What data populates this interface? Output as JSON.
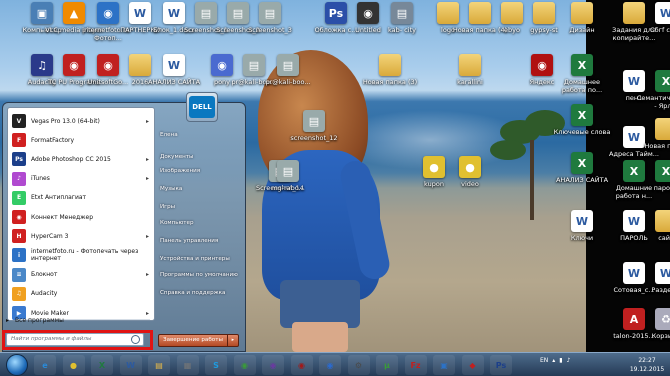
{
  "desktop_icons": [
    {
      "label": "Компьютер",
      "icon": "computer-icon",
      "color": "#4a7fb5",
      "x": "c"
    },
    {
      "label": "VLC media player",
      "icon": "vlc-icon",
      "color": "#f08a00"
    },
    {
      "label": "internetfoto.ru - Фотоп...",
      "icon": "app-icon",
      "color": "#2c72c6"
    },
    {
      "label": "ПАРТНЕРКИ",
      "icon": "doc-icon",
      "color": "#ffffff"
    },
    {
      "label": "Блок_1.docx",
      "icon": "doc-icon",
      "color": "#ffffff"
    },
    {
      "label": "Screenshot_1",
      "icon": "image-icon",
      "color": "#9aa"
    },
    {
      "label": "Screenshot_2",
      "icon": "image-icon",
      "color": "#9aa"
    },
    {
      "label": "Screenshot_3",
      "icon": "image-icon",
      "color": "#9aa"
    },
    {
      "label": "Обложка с...",
      "icon": "photoshop-icon",
      "color": "#2b4fa8"
    },
    {
      "label": "Untitled",
      "icon": "app-icon",
      "color": "#333"
    },
    {
      "label": "kab- city",
      "icon": "image-icon",
      "color": "#789"
    },
    {
      "label": "logo",
      "icon": "folder-icon",
      "color": "#e5b94a"
    },
    {
      "label": "Новая папка (4)",
      "icon": "folder-icon",
      "color": "#e5b94a"
    },
    {
      "label": "ebyo",
      "icon": "folder-icon",
      "color": "#e5b94a"
    },
    {
      "label": "gypsy-st",
      "icon": "folder-icon",
      "color": "#e5b94a"
    },
    {
      "label": "Дизайн",
      "icon": "folder-icon",
      "color": "#e5b94a"
    },
    {
      "label": "Задания для копирайте...",
      "icon": "folder-icon",
      "color": "#e5b94a"
    },
    {
      "label": "Сбгf сайт",
      "icon": "doc-icon",
      "color": "#ffffff"
    },
    {
      "label": "Audacity",
      "icon": "audacity-icon",
      "color": "#2a3a8a"
    },
    {
      "label": "TC PU Programs",
      "icon": "app-icon",
      "color": "#c02020"
    },
    {
      "label": "UnitsoftGo...",
      "icon": "app-icon",
      "color": "#c02020"
    },
    {
      "label": "2016",
      "icon": "folder-icon",
      "color": "#e5b94a"
    },
    {
      "label": "АНАЛИЗ САЙТА",
      "icon": "doc-icon",
      "color": "#ffffff"
    },
    {
      "label": "pony",
      "icon": "app-icon",
      "color": "#4a6ad0"
    },
    {
      "label": "pr@kali-boo...",
      "icon": "image-icon",
      "color": "#9aa"
    },
    {
      "label": "pr@kali-boo...",
      "icon": "image-icon",
      "color": "#9aa"
    },
    {
      "label": "screenshot_12",
      "icon": "image-icon",
      "color": "#9aa"
    },
    {
      "label": "Новая папка (3)",
      "icon": "folder-icon",
      "color": "#e5b94a"
    },
    {
      "label": "karallini",
      "icon": "folder-icon",
      "color": "#e5b94a"
    },
    {
      "label": "Яндекс",
      "icon": "app-icon",
      "color": "#b01010"
    },
    {
      "label": "Домашнее работа по...",
      "icon": "xls-icon",
      "color": "#1f7a3e"
    },
    {
      "label": "пен1",
      "icon": "doc-icon",
      "color": "#ffffff"
    },
    {
      "label": "Семантич... ядро - Ярл...",
      "icon": "xls-icon",
      "color": "#1f7a3e"
    },
    {
      "label": "Screenshot_14",
      "icon": "image-icon",
      "color": "#9aa"
    },
    {
      "label": "Ключевые слова",
      "icon": "xls-icon",
      "color": "#1f7a3e"
    },
    {
      "label": "Адреса Тайм...",
      "icon": "doc-icon",
      "color": "#ffffff"
    },
    {
      "label": "Новая папка",
      "icon": "folder-icon",
      "color": "#e5b94a"
    },
    {
      "label": "mg-rabo...",
      "icon": "image-icon",
      "color": "#9aa"
    },
    {
      "label": "kupon",
      "icon": "chrome-icon",
      "color": "#e0c030"
    },
    {
      "label": "video",
      "icon": "chrome-icon",
      "color": "#e0c030"
    },
    {
      "label": "АНАЛИЗ САЙТА",
      "icon": "xls-icon",
      "color": "#1f7a3e"
    },
    {
      "label": "Домашние работа н...",
      "icon": "xls-icon",
      "color": "#1f7a3e"
    },
    {
      "label": "пароли",
      "icon": "xls-icon",
      "color": "#1f7a3e"
    },
    {
      "label": "Ключи",
      "icon": "doc-icon",
      "color": "#ffffff"
    },
    {
      "label": "ПАРОЛЬ",
      "icon": "doc-icon",
      "color": "#ffffff"
    },
    {
      "label": "сайт",
      "icon": "folder-icon",
      "color": "#e5b94a"
    },
    {
      "label": "Сотовая_с...",
      "icon": "doc-icon",
      "color": "#ffffff"
    },
    {
      "label": "Разделы",
      "icon": "doc-icon",
      "color": "#ffffff"
    },
    {
      "label": "talon-2015...",
      "icon": "pdf-icon",
      "color": "#c02020"
    },
    {
      "label": "Корзина",
      "icon": "recycle-bin-icon",
      "color": "#aab"
    }
  ],
  "start_menu": {
    "left_items": [
      {
        "label": "Vegas Pro 13.0 (64-bit)",
        "icon": "vegas-icon",
        "color": "#222",
        "arrow": "▸"
      },
      {
        "label": "FormatFactory",
        "icon": "formatfactory-icon",
        "color": "#d02020",
        "arrow": ""
      },
      {
        "label": "Adobe Photoshop CC 2015",
        "icon": "photoshop-icon",
        "color": "#1c3f8a",
        "arrow": "▸"
      },
      {
        "label": "iTunes",
        "icon": "itunes-icon",
        "color": "#b04ad0",
        "arrow": "▸"
      },
      {
        "label": "Etxt Антиплагиат",
        "icon": "etxt-icon",
        "color": "#3c6",
        "arrow": ""
      },
      {
        "label": "Коннект Менеджер",
        "icon": "connect-icon",
        "color": "#d02020",
        "arrow": ""
      },
      {
        "label": "HyperCam 3",
        "icon": "hypercam-icon",
        "color": "#d02020",
        "arrow": "▸"
      },
      {
        "label": "internetfoto.ru - Фотопечать через интернет",
        "icon": "app-icon",
        "color": "#2c72c6",
        "arrow": ""
      },
      {
        "label": "Блокнот",
        "icon": "notepad-icon",
        "color": "#4a88c8",
        "arrow": "▸"
      },
      {
        "label": "Audacity",
        "icon": "audacity-icon",
        "color": "#f0a020",
        "arrow": ""
      },
      {
        "label": "Movie Maker",
        "icon": "moviemaker-icon",
        "color": "#3a7ad0",
        "arrow": "▸"
      }
    ],
    "all_programs": "Все программы",
    "search_placeholder": "Найти программы и файлы",
    "right_items": [
      "Елена",
      "Документы",
      "Изображения",
      "Музыка",
      "Игры",
      "Компьютер",
      "Панель управления",
      "Устройства и принтеры",
      "Программы по умолчанию",
      "Справка и поддержка"
    ],
    "shutdown_label": "Завершение работы",
    "user_logo": "DELL"
  },
  "taskbar": {
    "pinned": [
      {
        "icon": "ie-icon",
        "color": "#2a8ad8",
        "glyph": "e"
      },
      {
        "icon": "chrome-icon",
        "color": "#e0c030",
        "glyph": "●"
      },
      {
        "icon": "excel-icon",
        "color": "#1f7a3e",
        "glyph": "X"
      },
      {
        "icon": "word-icon",
        "color": "#2c5aa0",
        "glyph": "W"
      },
      {
        "icon": "explorer-icon",
        "color": "#e5b94a",
        "glyph": "▤"
      },
      {
        "icon": "calculator-icon",
        "color": "#777",
        "glyph": "▦"
      },
      {
        "icon": "skype-icon",
        "color": "#1e9be0",
        "glyph": "S"
      },
      {
        "icon": "app-icon",
        "color": "#3a9a3a",
        "glyph": "◉"
      },
      {
        "icon": "app-icon",
        "color": "#6a3aa0",
        "glyph": "◉"
      },
      {
        "icon": "app-icon",
        "color": "#a01a1a",
        "glyph": "◉"
      },
      {
        "icon": "app-icon",
        "color": "#2a6ad0",
        "glyph": "◉"
      },
      {
        "icon": "app-icon",
        "color": "#4a4a4a",
        "glyph": "⚙"
      },
      {
        "icon": "utorrent-icon",
        "color": "#3a9a3a",
        "glyph": "μ"
      },
      {
        "icon": "filezilla-icon",
        "color": "#c02020",
        "glyph": "Fz"
      },
      {
        "icon": "app-icon",
        "color": "#2c72c6",
        "glyph": "▣"
      },
      {
        "icon": "app-icon",
        "color": "#c02020",
        "glyph": "◆"
      },
      {
        "icon": "photoshop-icon",
        "color": "#1c3f8a",
        "glyph": "Ps"
      }
    ],
    "tray": {
      "lang": "EN",
      "time": "22:27",
      "date": "19.12.2015"
    }
  }
}
